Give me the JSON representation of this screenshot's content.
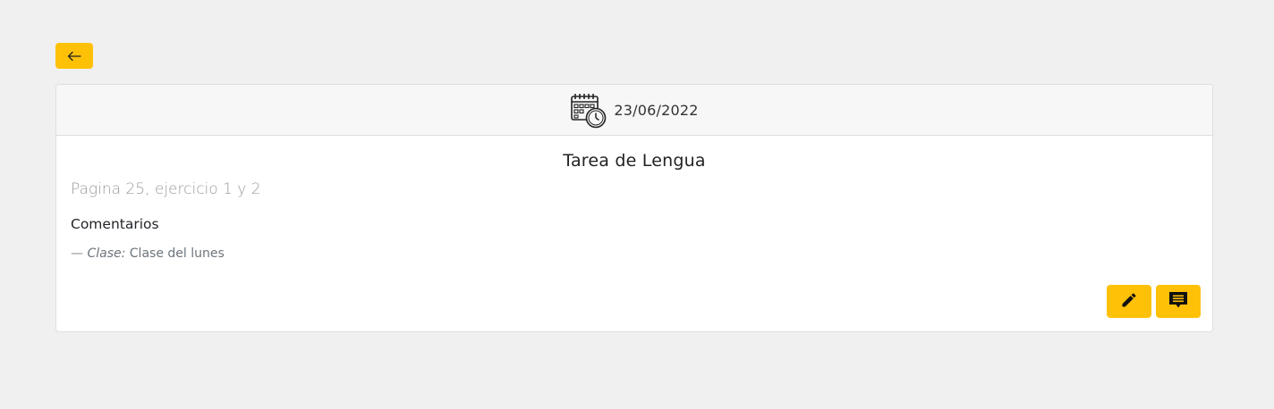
{
  "back_button": {
    "icon": "arrow-left-icon"
  },
  "card": {
    "header": {
      "icon": "calendar-clock-icon",
      "date": "23/06/2022"
    },
    "title": "Tarea de Lengua",
    "description": "Pagina 25, ejercicio 1 y 2",
    "comments_heading": "Comentarios",
    "comments": [
      {
        "dash": "—",
        "label": "Clase:",
        "text": "Clase del lunes"
      }
    ]
  },
  "actions": {
    "edit_icon": "pencil-icon",
    "comment_icon": "comment-icon"
  },
  "colors": {
    "accent": "#ffc107",
    "background": "#f0f0f0",
    "card_header": "#f7f7f7"
  }
}
